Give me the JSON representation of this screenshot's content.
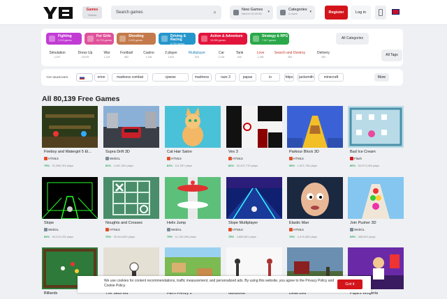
{
  "header": {
    "logo_text": "Y8",
    "games_label": "Games",
    "games_sub": "Videos",
    "search_placeholder": "Search games",
    "new_games": {
      "label": "New Games",
      "sub": "Next in 01:49:51"
    },
    "categories": {
      "label": "Categories",
      "sub": "& more"
    },
    "register": "Register",
    "login": "Log in"
  },
  "categories": [
    {
      "label": "Fighting",
      "count": "2,113 games",
      "color": "#c23bd4"
    },
    {
      "label": "For Girls",
      "count": "24,723 games",
      "color": "#e0519a"
    },
    {
      "label": "Shooting",
      "count": "9,039 games",
      "color": "#c47a4b"
    },
    {
      "label": "Driving & Racing",
      "count": "6,703 games",
      "color": "#2596cc"
    },
    {
      "label": "Action & Adventure",
      "count": "15,058 games",
      "color": "#e3143c"
    },
    {
      "label": "Strategy & RPG",
      "count": "7,617 games",
      "color": "#2ba84a"
    }
  ],
  "all_categories": "All Categories",
  "tags": [
    {
      "label": "Simulation",
      "count": "1,097"
    },
    {
      "label": "Dress Up",
      "count": "16,576"
    },
    {
      "label": "War",
      "count": "1,134"
    },
    {
      "label": "Football",
      "count": "582"
    },
    {
      "label": "Casino",
      "count": "1,136"
    },
    {
      "label": "2 player",
      "count": "1,831"
    },
    {
      "label": "Multiplayer",
      "count": "519"
    },
    {
      "label": "Car",
      "count": "2,126"
    },
    {
      "label": "Tank",
      "count": "640"
    },
    {
      "label": "Love",
      "count": "1,198"
    },
    {
      "label": "Search and Destroy",
      "count": "284"
    },
    {
      "label": "Delivery",
      "count": "269"
    }
  ],
  "all_tags": "All Tags",
  "top_searches": {
    "label": "TOP SEARCHES",
    "items": [
      "orion",
      "madness combat",
      "cpwsw",
      "madness",
      "raze 3",
      "papas",
      "io",
      "https",
      "jacksmith",
      "minecraft"
    ],
    "more": "More"
  },
  "section_title": "All 80,139 Free Games",
  "games": [
    {
      "name": "Fireboy and Watergirl 5 El...",
      "tech": "HTML5",
      "rating": "79%",
      "plays": "31,386,763 plays"
    },
    {
      "name": "Supra Drift 3D",
      "tech": "WebGL",
      "rating": "81%",
      "plays": "2,491,320 plays"
    },
    {
      "name": "Cat Hair Salon",
      "tech": "HTML5",
      "rating": "81%",
      "plays": "111,997 plays"
    },
    {
      "name": "Vex 3",
      "tech": "HTML5",
      "rating": "82%",
      "plays": "30,407,715 plays"
    },
    {
      "name": "Parkour Block 3D",
      "tech": "HTML5",
      "rating": "53%",
      "plays": "1,021,706 plays"
    },
    {
      "name": "Bad Ice Cream",
      "tech": "Flash",
      "rating": "80%",
      "plays": "53,974,158 plays"
    },
    {
      "name": "Slope",
      "tech": "WebGL",
      "rating": "82%",
      "plays": "95,215,135 plays"
    },
    {
      "name": "Noughts and Crosses",
      "tech": "HTML5",
      "rating": "70%",
      "plays": "39,944,663 plays"
    },
    {
      "name": "Helix Jump",
      "tech": "WebGL",
      "rating": "79%",
      "plays": "11,126,282 plays"
    },
    {
      "name": "Slope Multiplayer",
      "tech": "HTML5",
      "rating": "75%",
      "plays": "4,858,801 plays"
    },
    {
      "name": "Elastic Man",
      "tech": "HTML5",
      "rating": "79%",
      "plays": "4,474,639 plays"
    },
    {
      "name": "Join Pusher 3D",
      "tech": "WebGL",
      "rating": "69%",
      "plays": "458,801 plays"
    },
    {
      "name": "Billiards"
    },
    {
      "name": "The Skull Kid"
    },
    {
      "name": "Farm Frenzy 2"
    },
    {
      "name": "Gunblood"
    },
    {
      "name": "Dead Zed"
    },
    {
      "name": "Papa's Wingeria"
    }
  ],
  "cookie": {
    "text": "We use cookies for content recommendations, traffic measurement, and personalized ads. By using this website, you agree to the Privacy Policy and Cookie Policy.",
    "button": "Got it"
  }
}
